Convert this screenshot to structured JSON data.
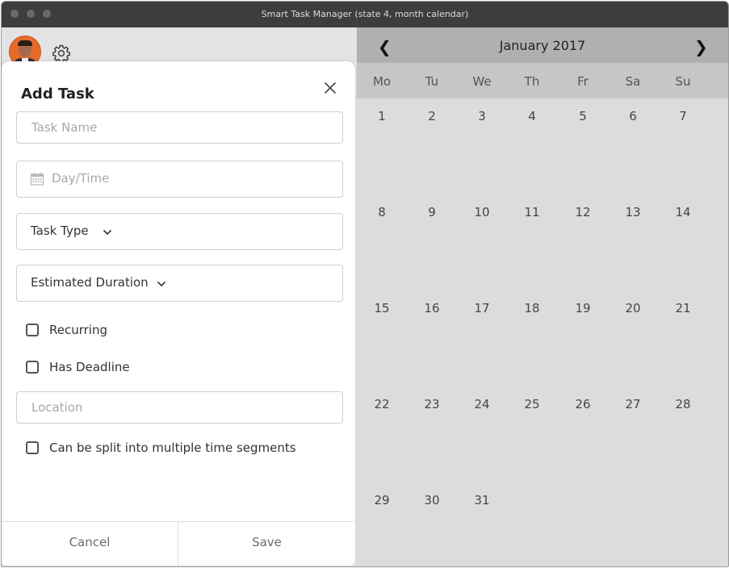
{
  "window": {
    "title": "Smart Task Manager (state 4, month calendar)"
  },
  "topbar": {
    "avatar_icon": "user-avatar",
    "settings_icon": "gear-icon"
  },
  "modal": {
    "title": "Add Task",
    "close_icon": "close-icon",
    "task_name": {
      "placeholder": "Task Name",
      "value": ""
    },
    "day_time": {
      "placeholder": "Day/Time",
      "icon": "calendar-icon"
    },
    "task_type": {
      "label": "Task Type",
      "icon": "chevron-down-icon"
    },
    "estimated_duration": {
      "label": "Estimated Duration",
      "icon": "chevron-down-icon"
    },
    "checkboxes": {
      "recurring": "Recurring",
      "has_deadline": "Has Deadline",
      "split": "Can be split into multiple time segments"
    },
    "location": {
      "placeholder": "Location"
    },
    "footer": {
      "cancel": "Cancel",
      "save": "Save"
    }
  },
  "calendar": {
    "month_label": "January 2017",
    "prev": "❮",
    "next": "❯",
    "weekdays": [
      "Mo",
      "Tu",
      "We",
      "Th",
      "Fr",
      "Sa",
      "Su"
    ],
    "weeks": [
      [
        "1",
        "2",
        "3",
        "4",
        "5",
        "6",
        "7"
      ],
      [
        "8",
        "9",
        "10",
        "11",
        "12",
        "13",
        "14"
      ],
      [
        "15",
        "16",
        "17",
        "18",
        "19",
        "20",
        "21"
      ],
      [
        "22",
        "23",
        "24",
        "25",
        "26",
        "27",
        "28"
      ],
      [
        "29",
        "30",
        "31",
        "",
        "",
        "",
        ""
      ]
    ]
  },
  "colors": {
    "titlebar": "#3d3d3d",
    "calendar_header": "#b0b0b0",
    "weekday_row": "#c6c6c6",
    "calendar_body": "#dcdcdc",
    "avatar_bg": "#e46b2c"
  }
}
